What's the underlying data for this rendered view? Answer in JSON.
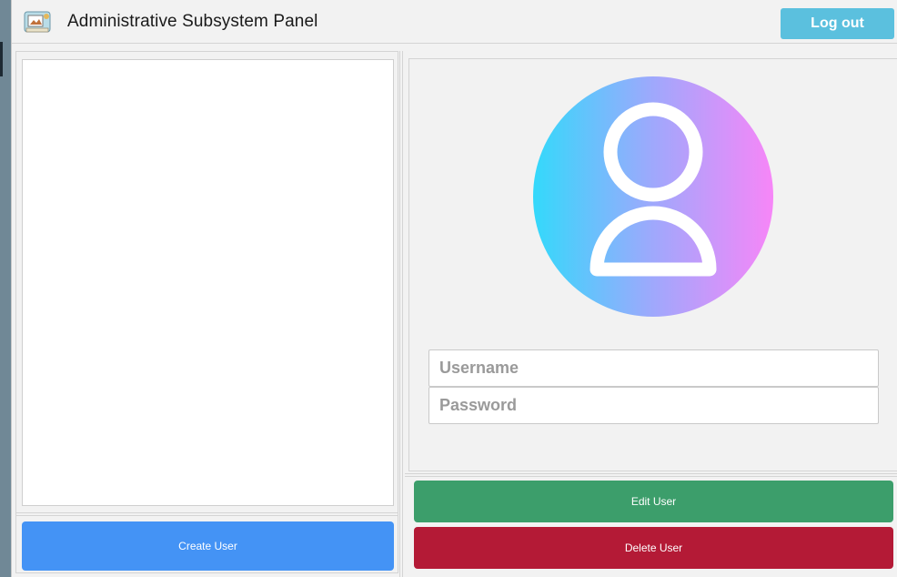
{
  "window": {
    "title": "Administrative Subsystem Panel",
    "app_icon": "admin-panel-icon"
  },
  "header": {
    "logout_label": "Log out"
  },
  "user_list": {
    "items": []
  },
  "actions": {
    "create_label": "Create User",
    "edit_label": "Edit User",
    "delete_label": "Delete User"
  },
  "form": {
    "avatar_icon": "user-avatar-icon",
    "username": {
      "value": "",
      "placeholder": "Username"
    },
    "password": {
      "value": "",
      "placeholder": "Password"
    }
  },
  "colors": {
    "logout": "#5bc0de",
    "create": "#4493f5",
    "edit": "#3c9e6b",
    "delete": "#b41a36",
    "avatar_gradient_start": "#33d9fb",
    "avatar_gradient_end": "#f786f8"
  }
}
